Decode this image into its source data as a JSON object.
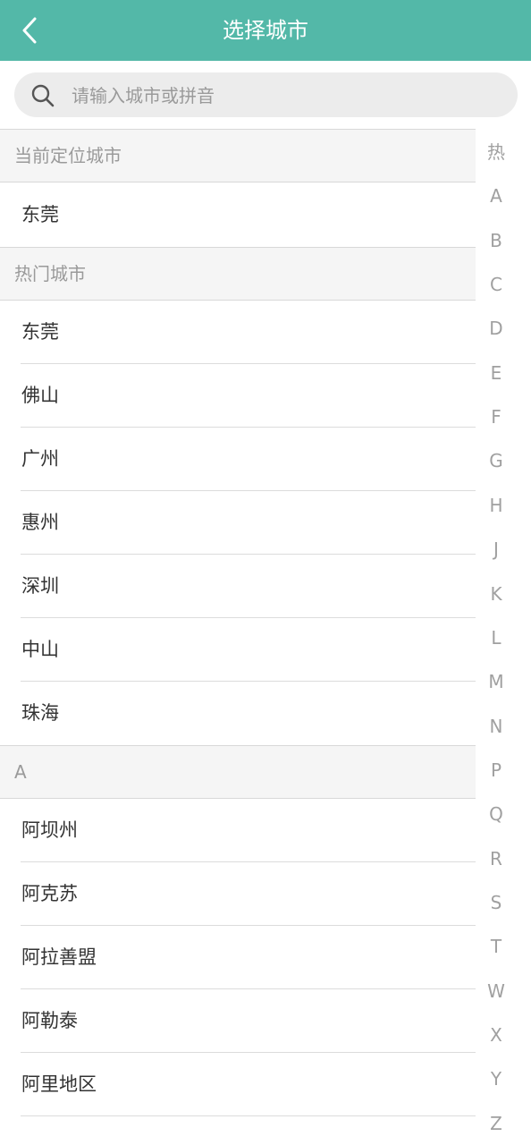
{
  "header": {
    "title": "选择城市"
  },
  "search": {
    "placeholder": "请输入城市或拼音"
  },
  "sections": {
    "current": {
      "title": "当前定位城市",
      "cities": [
        "东莞"
      ]
    },
    "hot": {
      "title": "热门城市",
      "cities": [
        "东莞",
        "佛山",
        "广州",
        "惠州",
        "深圳",
        "中山",
        "珠海"
      ]
    },
    "a": {
      "title": "A",
      "cities": [
        "阿坝州",
        "阿克苏",
        "阿拉善盟",
        "阿勒泰",
        "阿里地区"
      ]
    }
  },
  "index_bar": [
    "热",
    "A",
    "B",
    "C",
    "D",
    "E",
    "F",
    "G",
    "H",
    "J",
    "K",
    "L",
    "M",
    "N",
    "P",
    "Q",
    "R",
    "S",
    "T",
    "W",
    "X",
    "Y",
    "Z"
  ],
  "colors": {
    "header_bg": "#53b8a8",
    "section_bg": "#f5f5f5",
    "index_text": "#a0a0a0"
  },
  "icons": {
    "back": "chevron-left-icon",
    "search": "search-icon"
  }
}
